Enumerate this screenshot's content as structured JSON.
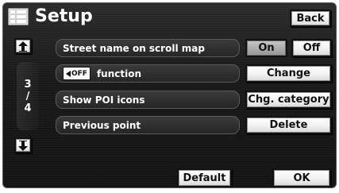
{
  "header": {
    "title": "Setup",
    "back_label": "Back",
    "menu_icon": "list-menu-icon"
  },
  "pager": {
    "current": "3",
    "separator": "/",
    "total": "4",
    "up_icon": "arrow-up-icon",
    "down_icon": "arrow-down-icon"
  },
  "settings": [
    {
      "label": "Street name on scroll map"
    },
    {
      "label": "function",
      "badge": "OFF"
    },
    {
      "label": "Show POI icons"
    },
    {
      "label": "Previous point"
    }
  ],
  "controls": {
    "on_label": "On",
    "off_label": "Off",
    "on_selected": true,
    "change_label": "Change",
    "change_category_label": "Chg. category",
    "delete_label": "Delete"
  },
  "footer": {
    "default_label": "Default",
    "ok_label": "OK"
  }
}
